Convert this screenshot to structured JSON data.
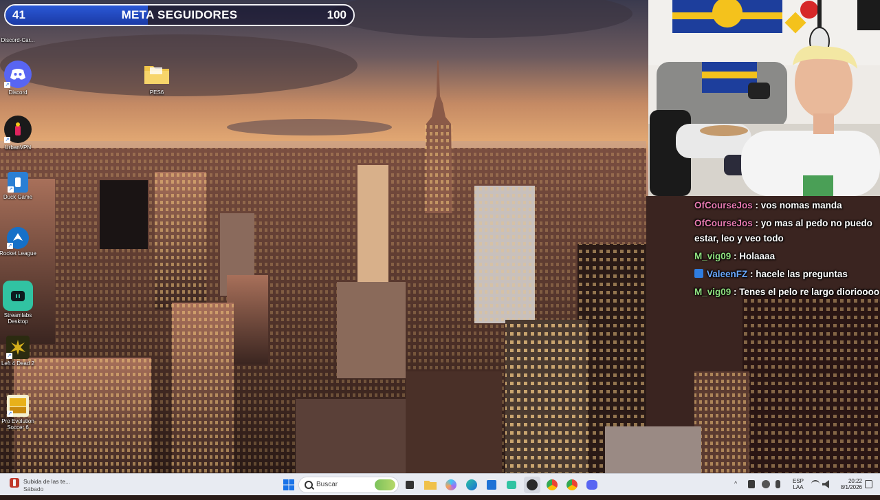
{
  "goal": {
    "current": "41",
    "title": "META SEGUIDORES",
    "target": "100",
    "progress_fraction": 0.41
  },
  "desktop_icons": [
    {
      "label": "Discord-Car...",
      "icon": "discord-car-icon"
    },
    {
      "label": "Discord",
      "icon": "discord-icon"
    },
    {
      "label": "PES6",
      "icon": "folder-icon"
    },
    {
      "label": "UrbanVPN",
      "icon": "urbanvpn-icon"
    },
    {
      "label": "Duck Game",
      "icon": "duck-game-icon"
    },
    {
      "label": "Rocket League",
      "icon": "rocket-league-icon"
    },
    {
      "label": "Streamlabs Desktop",
      "icon": "streamlabs-icon"
    },
    {
      "label": "Left 4 Dead 2",
      "icon": "left4dead2-icon"
    },
    {
      "label": "Pro Evolution Soccer 6",
      "icon": "pes-icon"
    }
  ],
  "chat": [
    {
      "user": "OfCourseJos",
      "message": "vos nomas manda",
      "color": "#e77ab0",
      "badge": false
    },
    {
      "user": "OfCourseJos",
      "message": "yo mas al pedo no puedo estar, leo y veo todo",
      "color": "#e77ab0",
      "badge": false
    },
    {
      "user": "M_vig09",
      "message": "Holaaaa",
      "color": "#8fe07f",
      "badge": false
    },
    {
      "user": "ValeenFZ",
      "message": "hacele las preguntas",
      "color": "#6aa8ff",
      "badge": true
    },
    {
      "user": "M_vig09",
      "message": "Tenes el pelo re largo diorioooo",
      "color": "#8fe07f",
      "badge": false
    }
  ],
  "taskbar": {
    "notification_title": "Subida de las te...",
    "notification_sub": "Sábado",
    "search_placeholder": "Buscar",
    "lang_1": "ESP",
    "lang_2": "LAA",
    "time": "20:22",
    "date": "8/1/2026"
  },
  "colors": {
    "goal_fill": "#2a58d6",
    "taskbar_bg": "#e8ebf2"
  }
}
